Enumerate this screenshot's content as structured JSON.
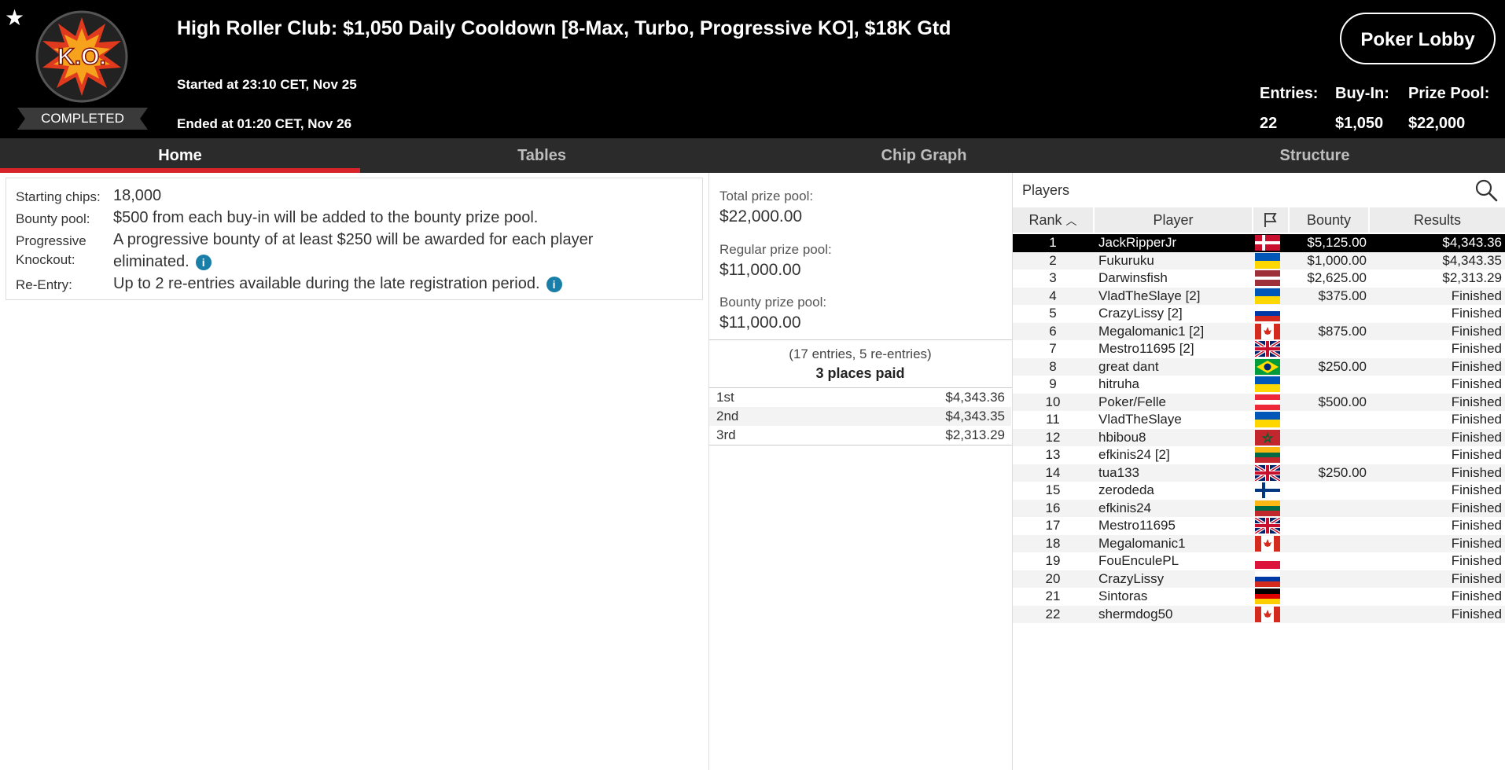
{
  "header": {
    "title": "High Roller Club: $1,050 Daily Cooldown [8-Max, Turbo, Progressive KO], $18K Gtd",
    "started": "Started at 23:10 CET, Nov 25",
    "ended": "Ended at 01:20 CET, Nov 26",
    "status_badge": "COMPLETED",
    "logo_text": "K.O.",
    "lobby_button": "Poker Lobby",
    "stats": [
      {
        "label": "Entries:",
        "value": "22"
      },
      {
        "label": "Buy-In:",
        "value": "$1,050"
      },
      {
        "label": "Prize Pool:",
        "value": "$22,000"
      }
    ]
  },
  "tabs": [
    "Home",
    "Tables",
    "Chip Graph",
    "Structure"
  ],
  "info": {
    "starting_chips_label": "Starting chips:",
    "starting_chips": "18,000",
    "bounty_pool_label": "Bounty pool:",
    "bounty_pool": "$500 from each buy-in will be added to the bounty prize pool.",
    "progressive_label_1": "Progressive",
    "progressive_label_2": "Knockout:",
    "progressive_1": "A progressive bounty of at least $250 will be awarded for each player",
    "progressive_2": "eliminated.",
    "reentry_label": "Re-Entry:",
    "reentry": "Up to 2 re-entries available during the late registration period."
  },
  "prize": {
    "total_label": "Total prize pool:",
    "total": "$22,000.00",
    "regular_label": "Regular prize pool:",
    "regular": "$11,000.00",
    "bounty_label": "Bounty prize pool:",
    "bounty": "$11,000.00",
    "entries_note": "(17 entries, 5 re-entries)",
    "places_paid": "3 places paid",
    "places": [
      {
        "place": "1st",
        "amount": "$4,343.36"
      },
      {
        "place": "2nd",
        "amount": "$4,343.35"
      },
      {
        "place": "3rd",
        "amount": "$2,313.29"
      }
    ]
  },
  "players": {
    "title": "Players",
    "columns": {
      "rank": "Rank",
      "player": "Player",
      "bounty": "Bounty",
      "results": "Results"
    },
    "rows": [
      {
        "rank": "1",
        "name": "JackRipperJr",
        "flag": "dk",
        "bounty": "$5,125.00",
        "result": "$4,343.36"
      },
      {
        "rank": "2",
        "name": "Fukuruku",
        "flag": "ua",
        "bounty": "$1,000.00",
        "result": "$4,343.35"
      },
      {
        "rank": "3",
        "name": "Darwinsfish",
        "flag": "lv",
        "bounty": "$2,625.00",
        "result": "$2,313.29"
      },
      {
        "rank": "4",
        "name": "VladTheSlaye [2]",
        "flag": "ua",
        "bounty": "$375.00",
        "result": "Finished"
      },
      {
        "rank": "5",
        "name": "CrazyLissy [2]",
        "flag": "ru",
        "bounty": "",
        "result": "Finished"
      },
      {
        "rank": "6",
        "name": "Megalomanic1 [2]",
        "flag": "ca",
        "bounty": "$875.00",
        "result": "Finished"
      },
      {
        "rank": "7",
        "name": "Mestro11695 [2]",
        "flag": "gb",
        "bounty": "",
        "result": "Finished"
      },
      {
        "rank": "8",
        "name": "great dant",
        "flag": "br",
        "bounty": "$250.00",
        "result": "Finished"
      },
      {
        "rank": "9",
        "name": "hitruha",
        "flag": "ua",
        "bounty": "",
        "result": "Finished"
      },
      {
        "rank": "10",
        "name": "Poker/Felle",
        "flag": "at",
        "bounty": "$500.00",
        "result": "Finished"
      },
      {
        "rank": "11",
        "name": "VladTheSlaye",
        "flag": "ua",
        "bounty": "",
        "result": "Finished"
      },
      {
        "rank": "12",
        "name": "hbibou8",
        "flag": "ma",
        "bounty": "",
        "result": "Finished"
      },
      {
        "rank": "13",
        "name": "efkinis24 [2]",
        "flag": "lt",
        "bounty": "",
        "result": "Finished"
      },
      {
        "rank": "14",
        "name": "tua133",
        "flag": "gb",
        "bounty": "$250.00",
        "result": "Finished"
      },
      {
        "rank": "15",
        "name": "zerodeda",
        "flag": "fi",
        "bounty": "",
        "result": "Finished"
      },
      {
        "rank": "16",
        "name": "efkinis24",
        "flag": "lt",
        "bounty": "",
        "result": "Finished"
      },
      {
        "rank": "17",
        "name": "Mestro11695",
        "flag": "gb",
        "bounty": "",
        "result": "Finished"
      },
      {
        "rank": "18",
        "name": "Megalomanic1",
        "flag": "ca",
        "bounty": "",
        "result": "Finished"
      },
      {
        "rank": "19",
        "name": "FouEnculePL",
        "flag": "pl",
        "bounty": "",
        "result": "Finished"
      },
      {
        "rank": "20",
        "name": "CrazyLissy",
        "flag": "ru",
        "bounty": "",
        "result": "Finished"
      },
      {
        "rank": "21",
        "name": "Sintoras",
        "flag": "de",
        "bounty": "",
        "result": "Finished"
      },
      {
        "rank": "22",
        "name": "shermdog50",
        "flag": "ca",
        "bounty": "",
        "result": "Finished"
      }
    ]
  },
  "colors": {
    "accent": "#d7232a",
    "info": "#1a7fa8",
    "header_bg": "#000000",
    "tab_bg": "#2b2b2b"
  }
}
